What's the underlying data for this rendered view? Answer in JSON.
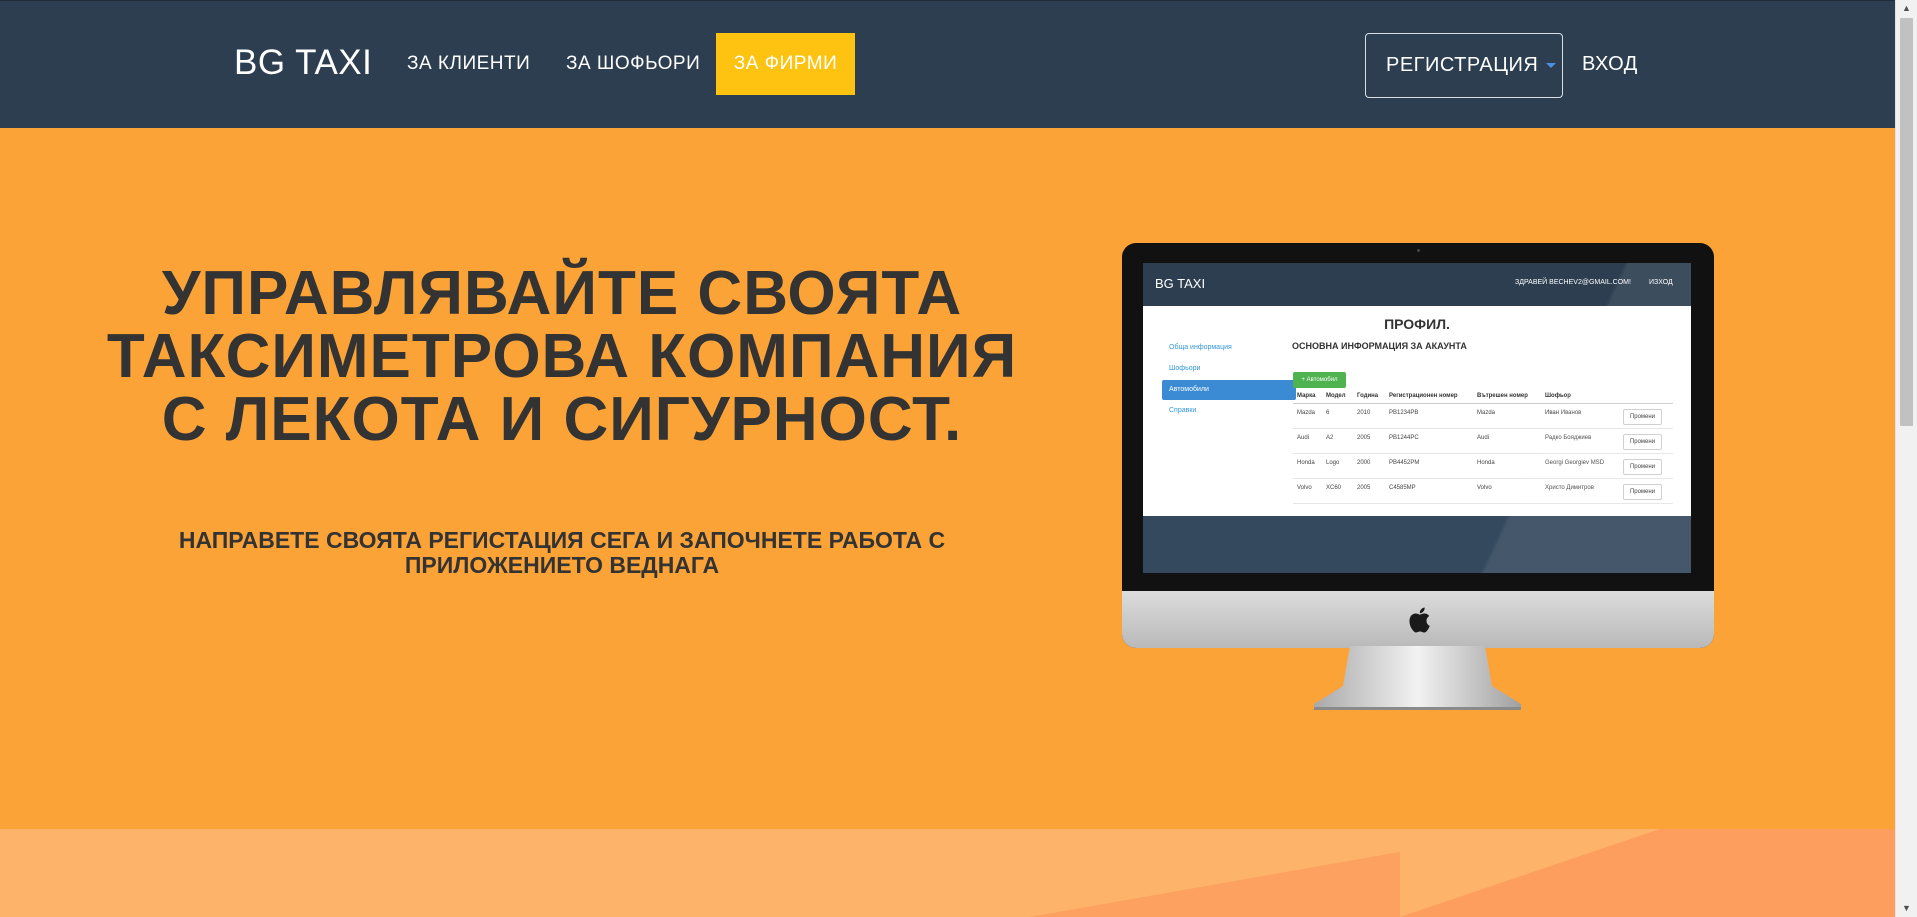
{
  "navbar": {
    "brand": "BG TAXI",
    "links": [
      "ЗА КЛИЕНТИ",
      "ЗА ШОФЬОРИ",
      "ЗА ФИРМИ"
    ],
    "register": "РЕГИСТРАЦИЯ",
    "login": "ВХОД",
    "active_color": "#fdc310",
    "background_color": "#2c3e50"
  },
  "hero": {
    "headline_lines": [
      "УПРАВЛЯВАЙТЕ СВОЯТА",
      "ТАКСИМЕТРОВА КОМПАНИЯ",
      "С ЛЕКОТА И СИГУРНОСТ."
    ],
    "subhead_lines": [
      "НАПРАВЕТЕ СВОЯТА РЕГИСТАЦИЯ СЕГА И ЗАПОЧНЕТЕ РАБОТА С",
      "ПРИЛОЖЕНИЕТО ВЕДНАГА"
    ],
    "background_color": "#fca337"
  },
  "monitor_screen": {
    "brand": "BG TAXI",
    "greeting": "ЗДРАВЕЙ BECHEV2@GMAIL.COM!",
    "logout": "ИЗХОД",
    "title": "ПРОФИЛ.",
    "subtitle": "ОСНОВНА ИНФОРМАЦИЯ ЗА АКАУНТА",
    "sidebar": [
      "Обща информация",
      "Шофьори",
      "Автомобили",
      "Справки"
    ],
    "add_button": "+ Автомобил",
    "table_headers": [
      "Марка",
      "Модел",
      "Година",
      "Регистрационен номер",
      "Вътрешен номер",
      "Шофьор"
    ],
    "rows": [
      [
        "Mazda",
        "6",
        "2010",
        "PB1234PB",
        "Mazda",
        "Иван Иванов"
      ],
      [
        "Audi",
        "A2",
        "2005",
        "PB1244PC",
        "Audi",
        "Радко Бояджиев"
      ],
      [
        "Honda",
        "Logo",
        "2000",
        "PB4452PM",
        "Honda",
        "Georgi Georgiev MSD"
      ],
      [
        "Volvo",
        "XC60",
        "2005",
        "C4585MP",
        "Volvo",
        "Христо Димитров"
      ]
    ],
    "row_button": "Промени"
  }
}
